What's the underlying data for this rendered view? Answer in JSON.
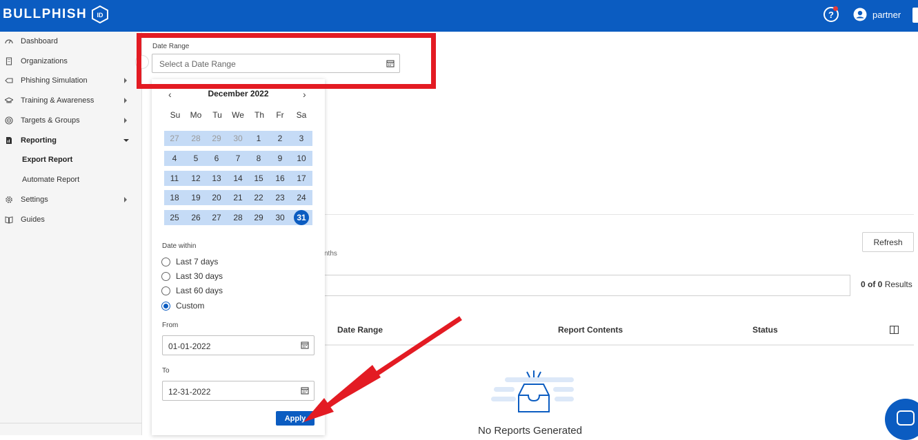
{
  "brand": {
    "name": "BULLPHISH",
    "badge": "ID"
  },
  "topbar": {
    "user_name": "partner",
    "help_icon": "question-circle-icon",
    "user_icon": "account-circle-icon"
  },
  "sidebar": {
    "items": [
      {
        "label": "Dashboard",
        "icon": "dashboard-icon"
      },
      {
        "label": "Organizations",
        "icon": "building-icon"
      },
      {
        "label": "Phishing Simulation",
        "icon": "hook-icon"
      },
      {
        "label": "Training & Awareness",
        "icon": "mortarboard-icon"
      },
      {
        "label": "Targets & Groups",
        "icon": "target-icon"
      },
      {
        "label": "Reporting",
        "icon": "report-icon"
      },
      {
        "label": "Settings",
        "icon": "gear-icon"
      },
      {
        "label": "Guides",
        "icon": "book-icon"
      }
    ],
    "reporting_sub": [
      {
        "label": "Export Report",
        "active": true
      },
      {
        "label": "Automate Report",
        "active": false
      }
    ]
  },
  "date_range": {
    "label": "Date Range",
    "placeholder": "Select a Date Range"
  },
  "calendar": {
    "month_label": "December 2022",
    "prev": "‹",
    "next": "›",
    "weekdays": [
      "Su",
      "Mo",
      "Tu",
      "We",
      "Th",
      "Fr",
      "Sa"
    ],
    "weeks": [
      [
        "27",
        "28",
        "29",
        "30",
        "1",
        "2",
        "3"
      ],
      [
        "4",
        "5",
        "6",
        "7",
        "8",
        "9",
        "10"
      ],
      [
        "11",
        "12",
        "13",
        "14",
        "15",
        "16",
        "17"
      ],
      [
        "18",
        "19",
        "20",
        "21",
        "22",
        "23",
        "24"
      ],
      [
        "25",
        "26",
        "27",
        "28",
        "29",
        "30",
        "31"
      ]
    ],
    "selected_day": "31"
  },
  "date_within": {
    "label": "Date within",
    "options": [
      "Last 7 days",
      "Last 30 days",
      "Last 60 days",
      "Custom"
    ],
    "selected": "Custom"
  },
  "from": {
    "label": "From",
    "value": "01-01-2022"
  },
  "to": {
    "label": "To",
    "value": "12-31-2022"
  },
  "apply_label": "Apply",
  "main": {
    "refresh_label": "Refresh",
    "months_fragment": "nths",
    "results": {
      "count": "0 of 0",
      "suffix": "Results"
    },
    "columns": [
      "Date Range",
      "Report Contents",
      "Status"
    ],
    "empty_text": "No Reports Generated"
  },
  "colors": {
    "brand_blue": "#0b5cc1",
    "annotation_red": "#e31b23",
    "range_highlight": "#c5dbf6"
  }
}
